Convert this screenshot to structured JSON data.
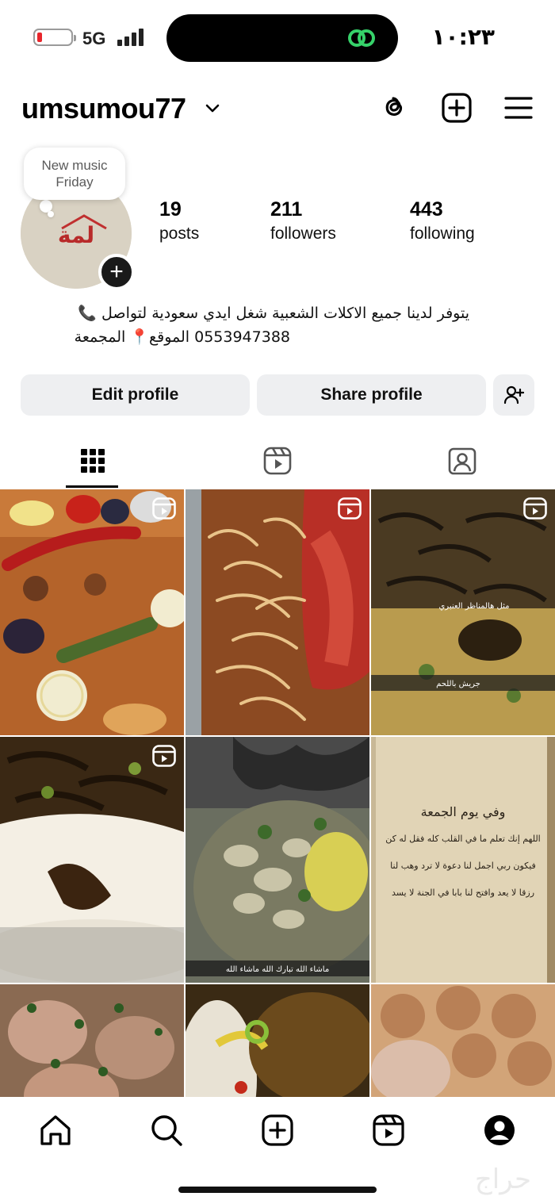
{
  "status_bar": {
    "network": "5G",
    "time": "١٠:٢٣"
  },
  "header": {
    "username": "umsumou77",
    "icons": [
      "threads-icon",
      "create-icon",
      "menu-icon"
    ]
  },
  "profile": {
    "note": "New music Friday",
    "avatar_logo_text": "لمة",
    "stats": [
      {
        "value": "19",
        "label": "posts"
      },
      {
        "value": "211",
        "label": "followers"
      },
      {
        "value": "443",
        "label": "following"
      }
    ],
    "bio_line1": "يتوفر لدينا جميع الاكلات الشعبية شغل ايدي سعودية لتواصل 📞",
    "bio_line2": "0553947388 الموقع📍 المجمعة"
  },
  "buttons": {
    "edit": "Edit profile",
    "share": "Share profile"
  },
  "tabs": [
    "grid-icon",
    "reels-icon",
    "tagged-icon"
  ],
  "grid": {
    "posts": [
      {
        "kind": "reel",
        "caption": ""
      },
      {
        "kind": "reel",
        "caption": ""
      },
      {
        "kind": "reel",
        "caption": "جريش باللحم"
      },
      {
        "kind": "reel",
        "caption": ""
      },
      {
        "kind": "post",
        "caption": "ماشاء الله تبارك الله ماشاء الله"
      },
      {
        "kind": "post",
        "caption": ""
      },
      {
        "kind": "post",
        "caption": ""
      },
      {
        "kind": "post",
        "caption": ""
      },
      {
        "kind": "post",
        "caption": ""
      }
    ],
    "post3_overlay": "مثل هالمناظر العنبري",
    "book_lines": [
      "وفي يوم الجمعة",
      "اللهم إنك تعلم ما في القلب كله فقل له كن",
      "فيكون ربي اجمل لنا دعوة لا ترد وهب لنا",
      "رزقا لا يعد وافتح لنا بابا في الجنة لا يسد"
    ]
  },
  "bottom_nav": [
    "home-icon",
    "search-icon",
    "create-icon",
    "reels-icon",
    "profile-icon"
  ],
  "watermark": "حراج",
  "colors": {
    "button_bg": "#eeeff1",
    "battery_low": "#e8262c",
    "island_link": "#36d26a"
  }
}
